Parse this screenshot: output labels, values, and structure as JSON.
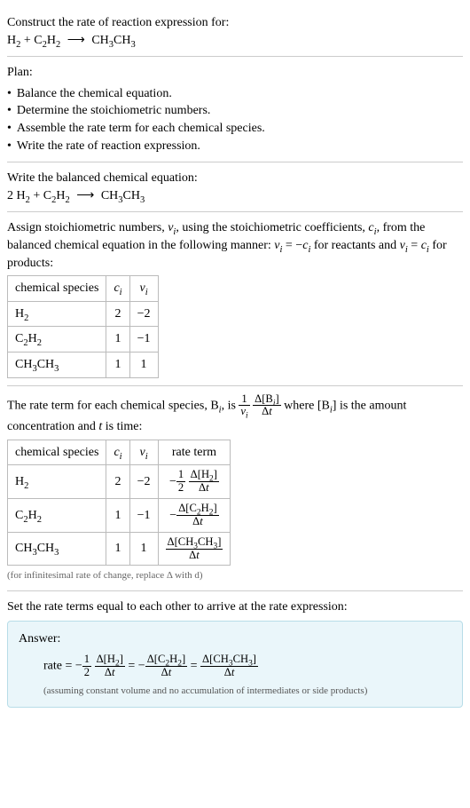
{
  "title": "Construct the rate of reaction expression for:",
  "plan_title": "Plan:",
  "plan_items": [
    "Balance the chemical equation.",
    "Determine the stoichiometric numbers.",
    "Assemble the rate term for each chemical species.",
    "Write the rate of reaction expression."
  ],
  "balanced_title": "Write the balanced chemical equation:",
  "stoich_text": {
    "part1": "Assign stoichiometric numbers, ",
    "part2": ", using the stoichiometric coefficients, ",
    "part3": ", from the balanced chemical equation in the following manner: ",
    "part4": " for reactants and ",
    "part5": " for products:"
  },
  "table1": {
    "headers": [
      "chemical species",
      "cᵢ",
      "νᵢ"
    ],
    "rows": [
      {
        "species": "H₂",
        "c": "2",
        "nu": "−2"
      },
      {
        "species": "C₂H₂",
        "c": "1",
        "nu": "−1"
      },
      {
        "species": "CH₃CH₃",
        "c": "1",
        "nu": "1"
      }
    ]
  },
  "rate_term_text": {
    "part1": "The rate term for each chemical species, B",
    "part2": ", is ",
    "part3": " where [B",
    "part4": "] is the amount concentration and ",
    "part5": " is time:"
  },
  "table2": {
    "headers": [
      "chemical species",
      "cᵢ",
      "νᵢ",
      "rate term"
    ]
  },
  "note": "(for infinitesimal rate of change, replace Δ with d)",
  "final_text": "Set the rate terms equal to each other to arrive at the rate expression:",
  "answer_label": "Answer:",
  "answer_note": "(assuming constant volume and no accumulation of intermediates or side products)",
  "chart_data": {
    "type": "table",
    "unbalanced_equation": "H₂ + C₂H₂ ⟶ CH₃CH₃",
    "balanced_equation": "2 H₂ + C₂H₂ ⟶ CH₃CH₃",
    "stoichiometry": [
      {
        "species": "H₂",
        "coefficient": 2,
        "nu": -2
      },
      {
        "species": "C₂H₂",
        "coefficient": 1,
        "nu": -1
      },
      {
        "species": "CH₃CH₃",
        "coefficient": 1,
        "nu": 1
      }
    ],
    "rate_terms": [
      {
        "species": "H₂",
        "c": 2,
        "nu": -2,
        "term": "-(1/2) Δ[H₂]/Δt"
      },
      {
        "species": "C₂H₂",
        "c": 1,
        "nu": -1,
        "term": "-Δ[C₂H₂]/Δt"
      },
      {
        "species": "CH₃CH₃",
        "c": 1,
        "nu": 1,
        "term": "Δ[CH₃CH₃]/Δt"
      }
    ],
    "rate_expression": "rate = -(1/2) Δ[H₂]/Δt = -Δ[C₂H₂]/Δt = Δ[CH₃CH₃]/Δt"
  }
}
